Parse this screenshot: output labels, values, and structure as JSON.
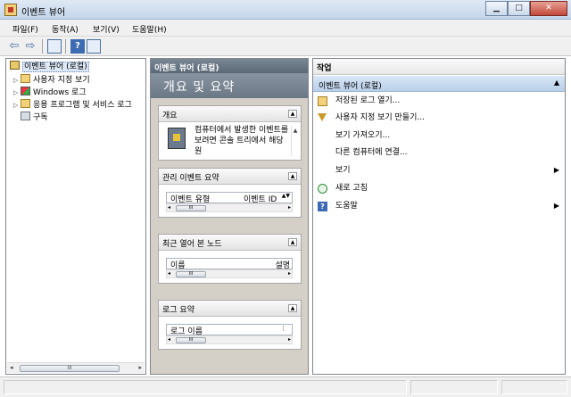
{
  "window": {
    "title": "이벤트 뷰어"
  },
  "menu": [
    "파일(F)",
    "동작(A)",
    "보기(V)",
    "도움말(H)"
  ],
  "tree": [
    {
      "label": "이벤트 뷰어 (로컬)",
      "level": 0,
      "selected": true,
      "icon": "event-viewer-icon"
    },
    {
      "label": "사용자 지정 보기",
      "level": 1,
      "icon": "custom-views-folder-icon"
    },
    {
      "label": "Windows 로그",
      "level": 1,
      "icon": "windows-logs-folder-icon"
    },
    {
      "label": "응용 프로그램 및 서비스 로그",
      "level": 1,
      "icon": "app-services-logs-folder-icon"
    },
    {
      "label": "구독",
      "level": 1,
      "icon": "subscriptions-icon"
    }
  ],
  "middle": {
    "header": "이벤트 뷰어 (로컬)",
    "banner": "개요 및 요약",
    "sections": {
      "overview": {
        "title": "개요",
        "text": "컴퓨터에서 발생한 이벤트를 보려면 콘솔 트리에서 해당 원"
      },
      "admin": {
        "title": "관리 이벤트 요약",
        "col1": "이벤트 유형",
        "col2": "이벤트 ID"
      },
      "recent": {
        "title": "최근 열어 본 노드",
        "col1": "이름",
        "col2": "설명"
      },
      "log": {
        "title": "로그 요약",
        "col1": "로그 이름"
      }
    }
  },
  "actions": {
    "title": "작업",
    "group": "이벤트 뷰어 (로컬)",
    "items": [
      {
        "label": "저장된 로그 열기...",
        "icon": "open-folder-icon",
        "submenu": false
      },
      {
        "label": "사용자 지정 보기 만들기...",
        "icon": "filter-icon",
        "submenu": false
      },
      {
        "label": "보기 가져오기...",
        "icon": "",
        "submenu": false
      },
      {
        "label": "다른 컴퓨터에 연결...",
        "icon": "",
        "submenu": false
      },
      {
        "label": "보기",
        "icon": "",
        "submenu": true
      },
      {
        "label": "새로 고침",
        "icon": "refresh-icon",
        "submenu": false
      },
      {
        "label": "도움말",
        "icon": "help-icon",
        "submenu": true
      }
    ]
  }
}
